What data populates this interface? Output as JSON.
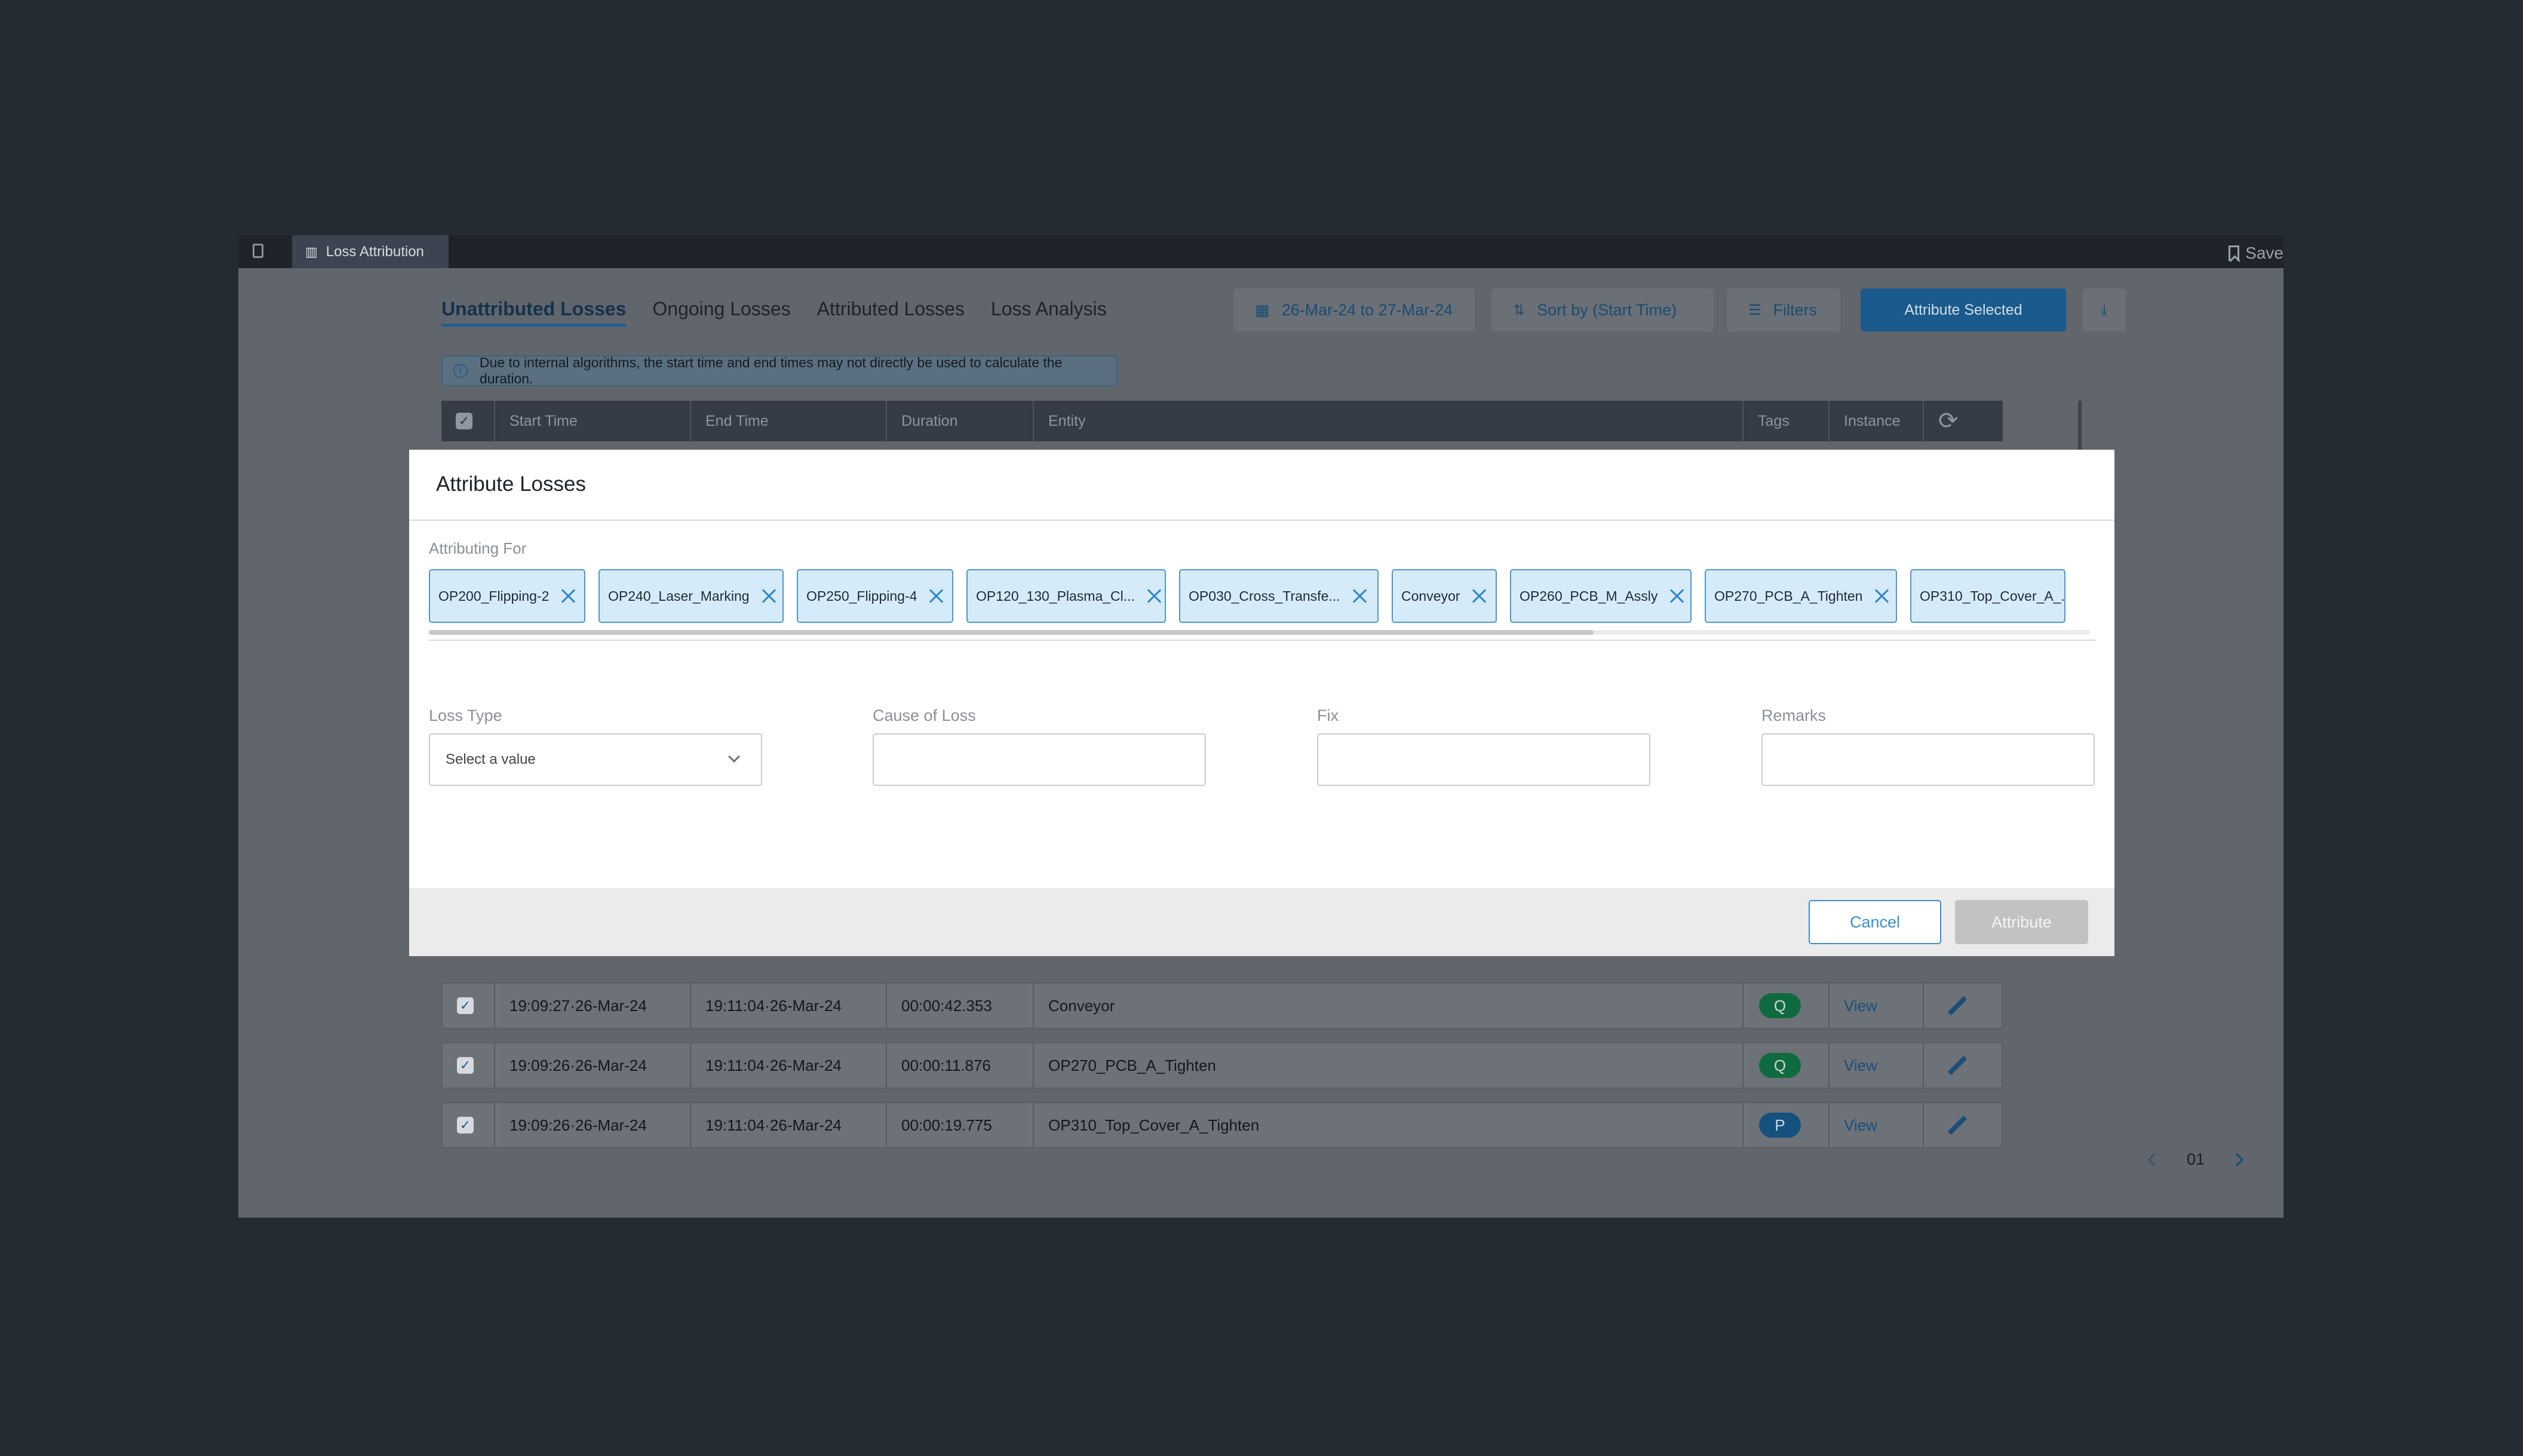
{
  "topbar": {
    "tab_label": "Loss Attribution",
    "save_label": "Save"
  },
  "main": {
    "tabs": [
      "Unattributed Losses",
      "Ongoing Losses",
      "Attributed Losses",
      "Loss Analysis"
    ],
    "date_range": "26-Mar-24 to 27-Mar-24",
    "sort_label": "Sort by (Start Time)",
    "filters_label": "Filters",
    "attribute_selected_label": "Attribute Selected",
    "note": "Due to internal algorithms, the start time and end times may not directly be used to calculate the duration.",
    "columns": [
      "Start Time",
      "End Time",
      "Duration",
      "Entity",
      "Tags",
      "Instance"
    ],
    "rows": [
      {
        "start": "19:09:27·26-Mar-24",
        "end": "19:11:04·26-Mar-24",
        "duration": "00:00:42.353",
        "entity": "Conveyor",
        "tag": "Q",
        "tag_color": "#0f6b3f",
        "instance": "View"
      },
      {
        "start": "19:09:26·26-Mar-24",
        "end": "19:11:04·26-Mar-24",
        "duration": "00:00:11.876",
        "entity": "OP270_PCB_A_Tighten",
        "tag": "Q",
        "tag_color": "#0f6b3f",
        "instance": "View"
      },
      {
        "start": "19:09:26·26-Mar-24",
        "end": "19:11:04·26-Mar-24",
        "duration": "00:00:19.775",
        "entity": "OP310_Top_Cover_A_Tighten",
        "tag": "P",
        "tag_color": "#14517f",
        "instance": "View"
      }
    ],
    "pager": {
      "page": "01"
    }
  },
  "modal": {
    "title": "Attribute Losses",
    "attributing_for_label": "Attributing For",
    "chips": [
      "OP200_Flipping-2",
      "OP240_Laser_Marking",
      "OP250_Flipping-4",
      "OP120_130_Plasma_Cl...",
      "OP030_Cross_Transfe...",
      "Conveyor",
      "OP260_PCB_M_Assly",
      "OP270_PCB_A_Tighten",
      "OP310_Top_Cover_A_..."
    ],
    "fields": {
      "loss_type_label": "Loss Type",
      "loss_type_value": "Select a value",
      "cause_label": "Cause of Loss",
      "cause_value": "",
      "fix_label": "Fix",
      "fix_value": "",
      "remarks_label": "Remarks",
      "remarks_value": ""
    },
    "cancel_label": "Cancel",
    "attribute_label": "Attribute"
  },
  "colors": {
    "accent": "#1a5a8c",
    "chip_bg": "#d6ebf9",
    "chip_border": "#4b97cf",
    "disabled_button": "#c2c2c2"
  }
}
